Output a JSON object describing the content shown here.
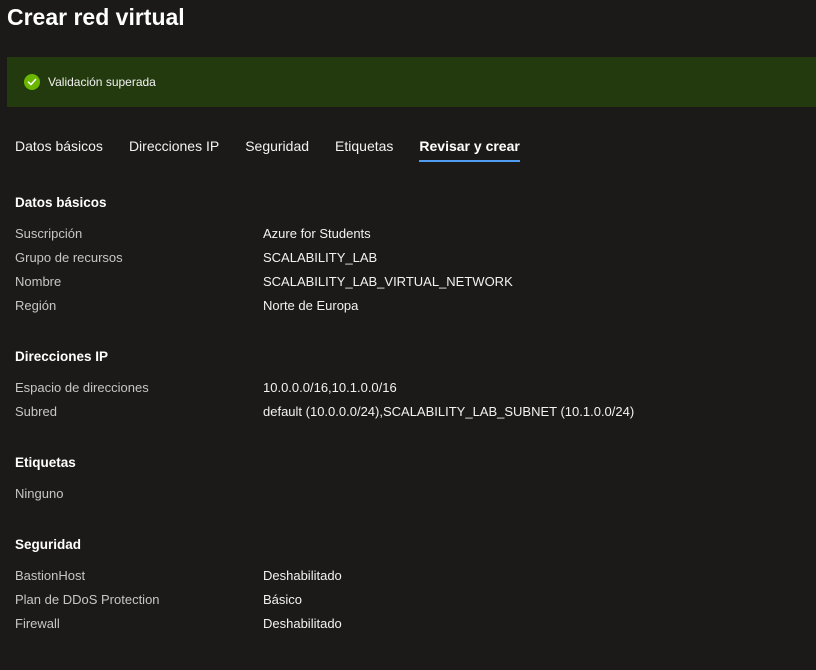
{
  "page": {
    "title": "Crear red virtual"
  },
  "banner": {
    "icon": "check-circle-icon",
    "text": "Validación superada",
    "color": "#233a0e"
  },
  "tabs": [
    {
      "label": "Datos básicos",
      "active": false
    },
    {
      "label": "Direcciones IP",
      "active": false
    },
    {
      "label": "Seguridad",
      "active": false
    },
    {
      "label": "Etiquetas",
      "active": false
    },
    {
      "label": "Revisar y crear",
      "active": true
    }
  ],
  "sections": {
    "basics": {
      "heading": "Datos básicos",
      "rows": [
        {
          "label": "Suscripción",
          "value": "Azure for Students"
        },
        {
          "label": "Grupo de recursos",
          "value": "SCALABILITY_LAB"
        },
        {
          "label": "Nombre",
          "value": "SCALABILITY_LAB_VIRTUAL_NETWORK"
        },
        {
          "label": "Región",
          "value": "Norte de Europa"
        }
      ]
    },
    "ip": {
      "heading": "Direcciones IP",
      "rows": [
        {
          "label": "Espacio de direcciones",
          "value": "10.0.0.0/16,10.1.0.0/16"
        },
        {
          "label": "Subred",
          "value": "default (10.0.0.0/24),SCALABILITY_LAB_SUBNET (10.1.0.0/24)"
        }
      ]
    },
    "tags": {
      "heading": "Etiquetas",
      "rows": [
        {
          "label": "Ninguno",
          "value": ""
        }
      ]
    },
    "security": {
      "heading": "Seguridad",
      "rows": [
        {
          "label": "BastionHost",
          "value": "Deshabilitado"
        },
        {
          "label": "Plan de DDoS Protection",
          "value": "Básico"
        },
        {
          "label": "Firewall",
          "value": "Deshabilitado"
        }
      ]
    }
  }
}
